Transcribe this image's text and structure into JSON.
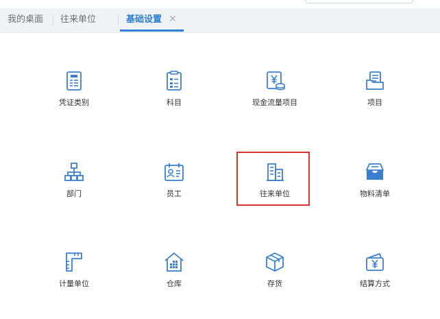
{
  "tabs": [
    {
      "label": "我的桌面"
    },
    {
      "label": "往来单位"
    },
    {
      "label": "基础设置",
      "close": "✕"
    }
  ],
  "grid": {
    "items": [
      {
        "label": "凭证类别",
        "icon": "voucher-category-icon"
      },
      {
        "label": "科目",
        "icon": "subject-clipboard-icon"
      },
      {
        "label": "现金流量项目",
        "icon": "cash-flow-icon"
      },
      {
        "label": "项目",
        "icon": "project-folder-icon"
      },
      {
        "label": "部门",
        "icon": "org-chart-icon"
      },
      {
        "label": "员工",
        "icon": "employee-card-icon"
      },
      {
        "label": "往来单位",
        "icon": "building-icon"
      },
      {
        "label": "物料清单",
        "icon": "inbox-tray-icon"
      },
      {
        "label": "计量单位",
        "icon": "ruler-icon"
      },
      {
        "label": "仓库",
        "icon": "warehouse-icon"
      },
      {
        "label": "存货",
        "icon": "inventory-box-icon"
      },
      {
        "label": "结算方式",
        "icon": "settlement-wallet-icon"
      }
    ]
  },
  "colors": {
    "accent": "#2f7fd6",
    "icon": "#3a7fcf",
    "highlight": "#d9352f"
  }
}
